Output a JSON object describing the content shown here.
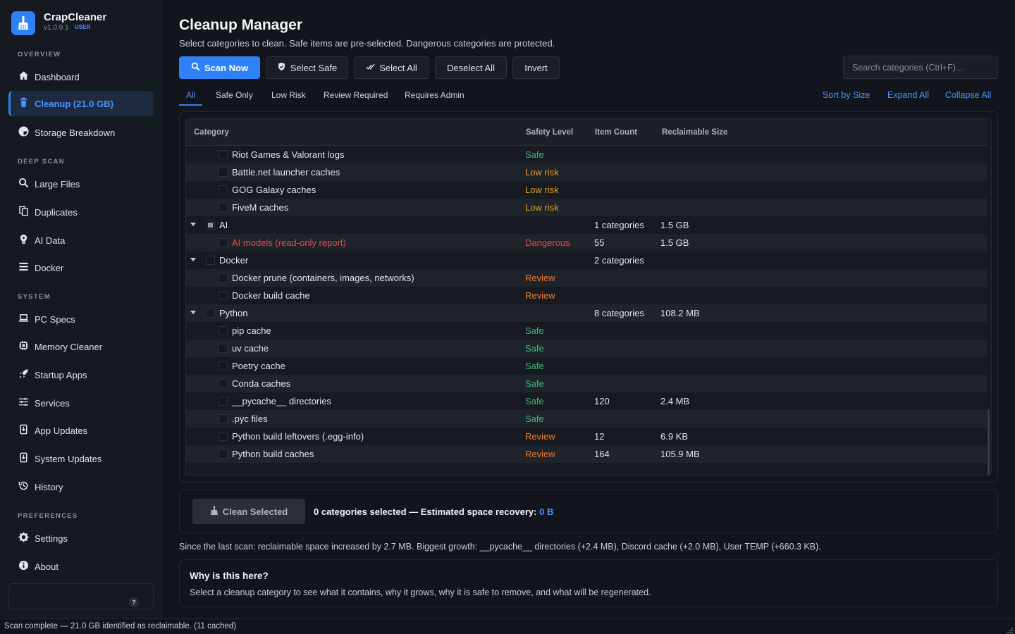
{
  "app": {
    "name": "CrapCleaner",
    "version": "v1.0.9.1",
    "badge": "USER"
  },
  "sidebar": {
    "sections": [
      {
        "label": "OVERVIEW"
      },
      {
        "label": "DEEP SCAN"
      },
      {
        "label": "SYSTEM"
      },
      {
        "label": "PREFERENCES"
      }
    ],
    "items": [
      {
        "label": "Dashboard",
        "icon": "home-icon"
      },
      {
        "label": "Cleanup  (21.0 GB)",
        "icon": "trash-icon",
        "active": true
      },
      {
        "label": "Storage Breakdown",
        "icon": "pie-chart-icon"
      },
      {
        "label": "Large Files",
        "icon": "search-icon"
      },
      {
        "label": "Duplicates",
        "icon": "copy-icon"
      },
      {
        "label": "AI Data",
        "icon": "brain-icon"
      },
      {
        "label": "Docker",
        "icon": "list-icon"
      },
      {
        "label": "PC Specs",
        "icon": "laptop-icon"
      },
      {
        "label": "Memory Cleaner",
        "icon": "chip-icon"
      },
      {
        "label": "Startup Apps",
        "icon": "rocket-icon"
      },
      {
        "label": "Services",
        "icon": "sliders-icon"
      },
      {
        "label": "App Updates",
        "icon": "download-icon"
      },
      {
        "label": "System Updates",
        "icon": "download-icon"
      },
      {
        "label": "History",
        "icon": "history-icon"
      },
      {
        "label": "Settings",
        "icon": "gear-icon"
      },
      {
        "label": "About",
        "icon": "info-icon"
      }
    ],
    "help": "?"
  },
  "header": {
    "title": "Cleanup Manager",
    "subtitle": "Select categories to clean. Safe items are pre-selected. Dangerous categories are protected."
  },
  "toolbar": {
    "scan_now": "Scan Now",
    "select_safe": "Select Safe",
    "select_all": "Select All",
    "deselect_all": "Deselect All",
    "invert": "Invert",
    "search_placeholder": "Search categories (Ctrl+F)..."
  },
  "tabs": [
    "All",
    "Safe Only",
    "Low Risk",
    "Review Required",
    "Requires Admin"
  ],
  "links": {
    "sort": "Sort by Size",
    "expand": "Expand All",
    "collapse": "Collapse All"
  },
  "table": {
    "columns": [
      "Category",
      "Safety Level",
      "Item Count",
      "Reclaimable Size"
    ],
    "rows": [
      {
        "type": "child",
        "name": "Riot Games & Valorant logs",
        "safety": "Safe",
        "level": "safe",
        "count": "",
        "size": ""
      },
      {
        "type": "child",
        "name": "Battle.net launcher caches",
        "safety": "Low risk",
        "level": "low",
        "count": "",
        "size": ""
      },
      {
        "type": "child",
        "name": "GOG Galaxy caches",
        "safety": "Low risk",
        "level": "low",
        "count": "",
        "size": ""
      },
      {
        "type": "child",
        "name": "FiveM caches",
        "safety": "Low risk",
        "level": "low",
        "count": "",
        "size": ""
      },
      {
        "type": "group",
        "name": "AI",
        "safety": "",
        "level": "",
        "count": "1 categories",
        "size": "1.5 GB",
        "partial": true
      },
      {
        "type": "child",
        "name": "AI models (read-only report)",
        "safety": "Dangerous",
        "level": "danger",
        "count": "55",
        "size": "1.5 GB",
        "danger": true
      },
      {
        "type": "group",
        "name": "Docker",
        "safety": "",
        "level": "",
        "count": "2 categories",
        "size": ""
      },
      {
        "type": "child",
        "name": "Docker prune (containers, images, networks)",
        "safety": "Review",
        "level": "review",
        "count": "",
        "size": ""
      },
      {
        "type": "child",
        "name": "Docker build cache",
        "safety": "Review",
        "level": "review",
        "count": "",
        "size": ""
      },
      {
        "type": "group",
        "name": "Python",
        "safety": "",
        "level": "",
        "count": "8 categories",
        "size": "108.2 MB"
      },
      {
        "type": "child",
        "name": "pip cache",
        "safety": "Safe",
        "level": "safe",
        "count": "",
        "size": ""
      },
      {
        "type": "child",
        "name": "uv cache",
        "safety": "Safe",
        "level": "safe",
        "count": "",
        "size": ""
      },
      {
        "type": "child",
        "name": "Poetry cache",
        "safety": "Safe",
        "level": "safe",
        "count": "",
        "size": ""
      },
      {
        "type": "child",
        "name": "Conda caches",
        "safety": "Safe",
        "level": "safe",
        "count": "",
        "size": ""
      },
      {
        "type": "child",
        "name": "__pycache__ directories",
        "safety": "Safe",
        "level": "safe",
        "count": "120",
        "size": "2.4 MB"
      },
      {
        "type": "child",
        "name": ".pyc files",
        "safety": "Safe",
        "level": "safe",
        "count": "",
        "size": ""
      },
      {
        "type": "child",
        "name": "Python build leftovers (.egg-info)",
        "safety": "Review",
        "level": "review",
        "count": "12",
        "size": "6.9 KB"
      },
      {
        "type": "child",
        "name": "Python build caches",
        "safety": "Review",
        "level": "review",
        "count": "164",
        "size": "105.9 MB"
      }
    ]
  },
  "action": {
    "clean_label": "Clean Selected",
    "selection_text": "0 categories selected — Estimated space recovery: ",
    "selection_value": "0 B"
  },
  "since": "Since the last scan: reclaimable space increased by 2.7 MB. Biggest growth: __pycache__ directories (+2.4 MB), Discord cache (+2.0 MB), User TEMP (+660.3 KB).",
  "why": {
    "title": "Why is this here?",
    "body": "Select a cleanup category to see what it contains, why it grows, why it is safe to remove, and what will be regenerated."
  },
  "status": "Scan complete — 21.0 GB identified as reclaimable. (11 cached)",
  "colors": {
    "accent": "#2f81f7",
    "safe": "#3fb87f",
    "low_risk": "#e0a021",
    "review": "#ee7a2c",
    "dangerous": "#e5484d"
  }
}
